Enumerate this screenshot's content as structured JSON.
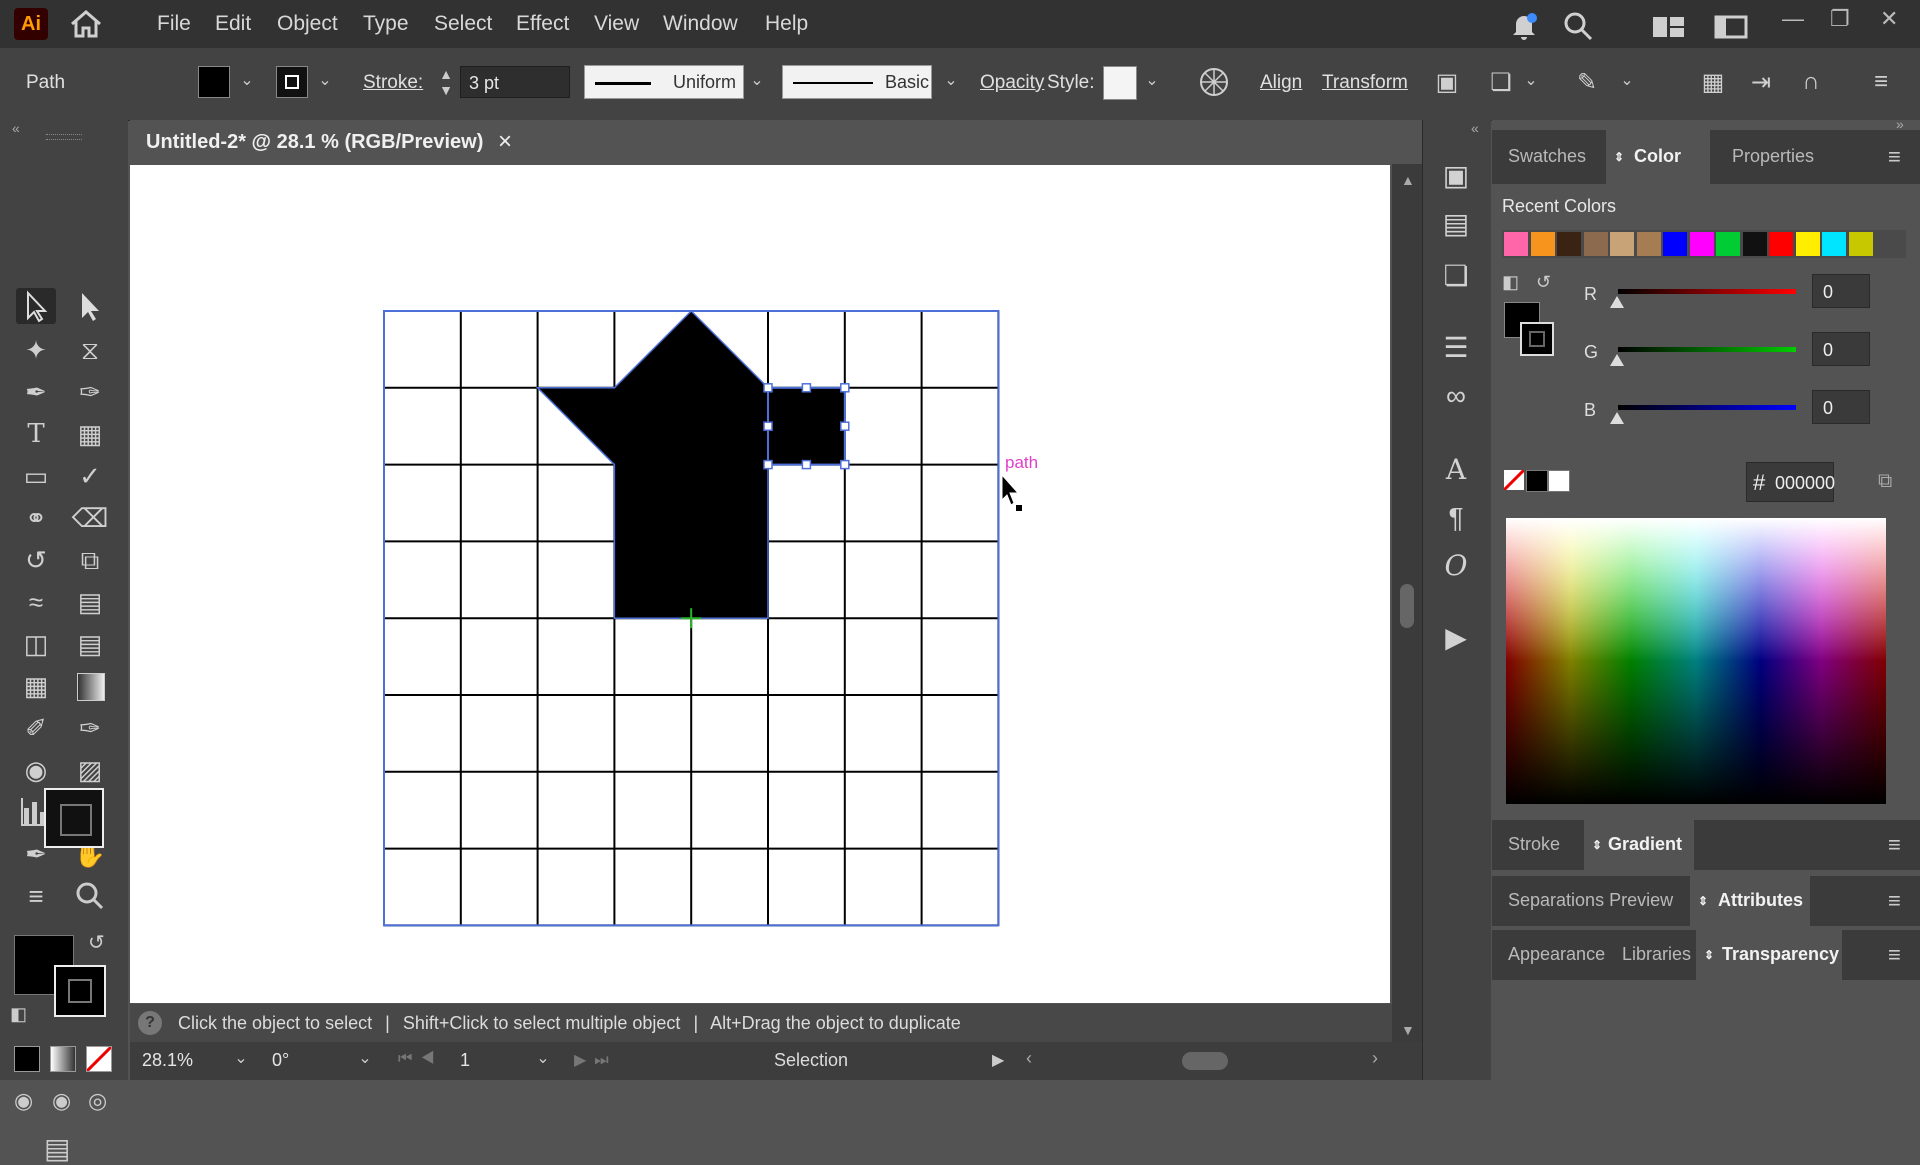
{
  "app": {
    "logo": "Ai",
    "menu": [
      "File",
      "Edit",
      "Object",
      "Type",
      "Select",
      "Effect",
      "View",
      "Window",
      "Help"
    ]
  },
  "control_bar": {
    "selection_type": "Path",
    "stroke_label": "Stroke:",
    "stroke_weight": "3 pt",
    "stroke_profile": "Uniform",
    "brush": "Basic",
    "opacity_label": "Opacity",
    "style_label": "Style:",
    "align_label": "Align",
    "transform_label": "Transform"
  },
  "document": {
    "tab_title": "Untitled-2* @ 28.1 % (RGB/Preview)",
    "close_glyph": "×",
    "hover_label": "path",
    "shape_fill": "#000000",
    "grid_line_color": "#000000",
    "selection_color": "#4d6fd8",
    "smart_guide_color": "#e040c8"
  },
  "status": {
    "help_glyph": "?",
    "hint_1": "Click the object to select",
    "hint_2": "Shift+Click to select multiple object",
    "hint_3": "Alt+Drag the object to duplicate",
    "separator": "|",
    "zoom": "28.1%",
    "rotation": "0°",
    "artboard_number": "1",
    "current_tool": "Selection"
  },
  "panels": {
    "top_tabs": [
      "Swatches",
      "Color",
      "Properties"
    ],
    "active_top_tab": "Color",
    "recent_colors_label": "Recent Colors",
    "recent_colors": [
      "#ff66aa",
      "#f7941d",
      "#3b2314",
      "#8b6a4e",
      "#c8a378",
      "#a67c52",
      "#0000ff",
      "#ff00ff",
      "#00cc33",
      "#111111",
      "#ff0000",
      "#ffee00",
      "#00e5ff",
      "#c8c800"
    ],
    "r_label": "R",
    "r_value": "0",
    "g_label": "G",
    "g_value": "0",
    "b_label": "B",
    "b_value": "0",
    "hex_symbol": "#",
    "hex_value": "000000",
    "group2_tabs": [
      "Stroke",
      "Gradient"
    ],
    "group3_tabs": [
      "Separations Preview",
      "Attributes"
    ],
    "group4_tabs": [
      "Appearance",
      "Libraries",
      "Transparency"
    ]
  },
  "icons": {
    "home": "home-icon",
    "bell": "bell-icon",
    "search": "search-icon",
    "workspace": "workspace-icon",
    "arrange": "arrange-documents-icon"
  }
}
